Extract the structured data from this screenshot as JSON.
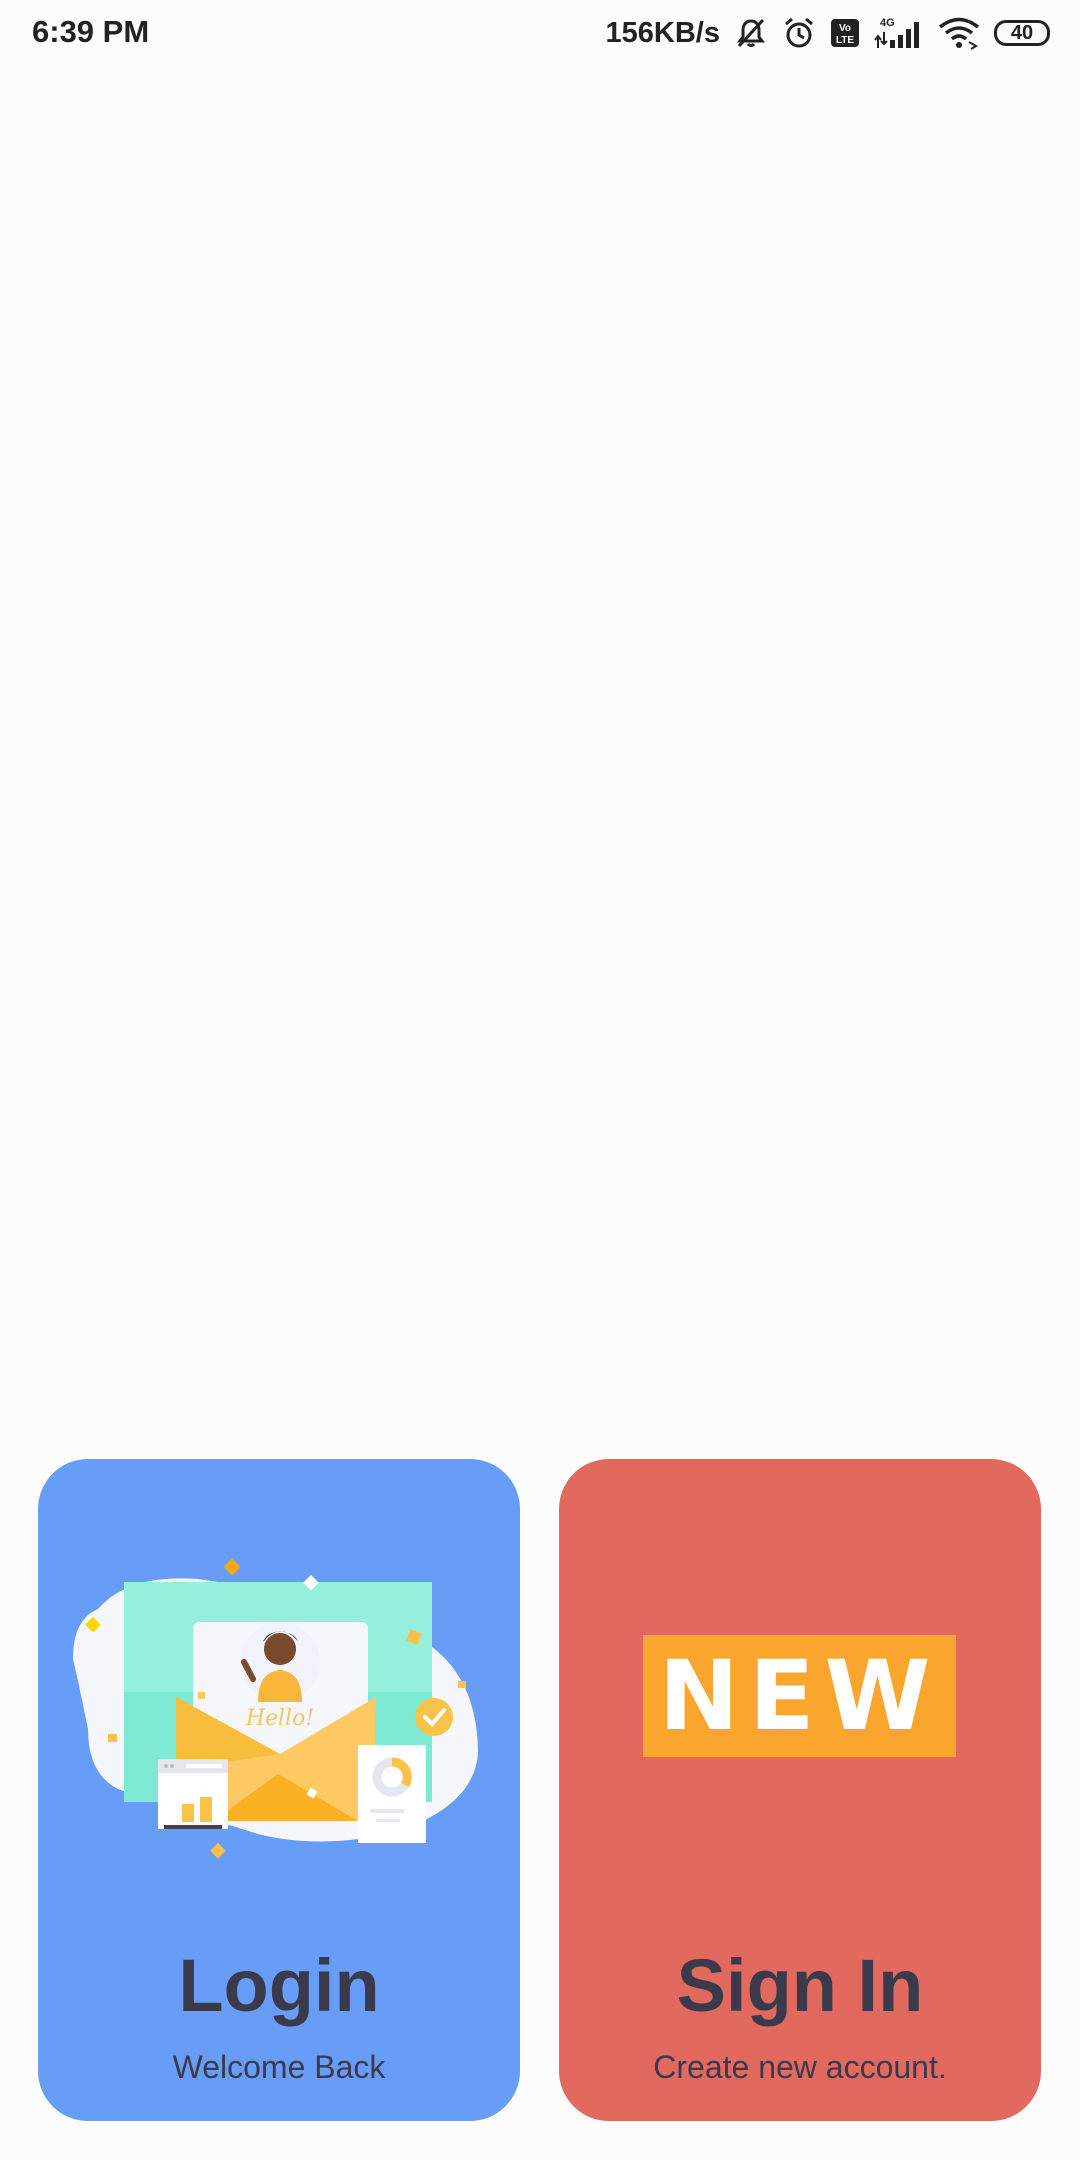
{
  "status_bar": {
    "time": "6:39 PM",
    "net_speed": "156KB/s",
    "icons": [
      "mute-icon",
      "alarm-icon",
      "volte-icon",
      "signal-4g-icon",
      "wifi-icon"
    ],
    "battery": "40"
  },
  "cards": {
    "login": {
      "title": "Login",
      "subtitle": "Welcome Back",
      "color": "#679DF6",
      "illustration_text": "Hello!"
    },
    "signin": {
      "title": "Sign In",
      "subtitle": "Create new account.",
      "color": "#E1695E",
      "badge": "NEW",
      "badge_color": "#FAA62E"
    }
  }
}
